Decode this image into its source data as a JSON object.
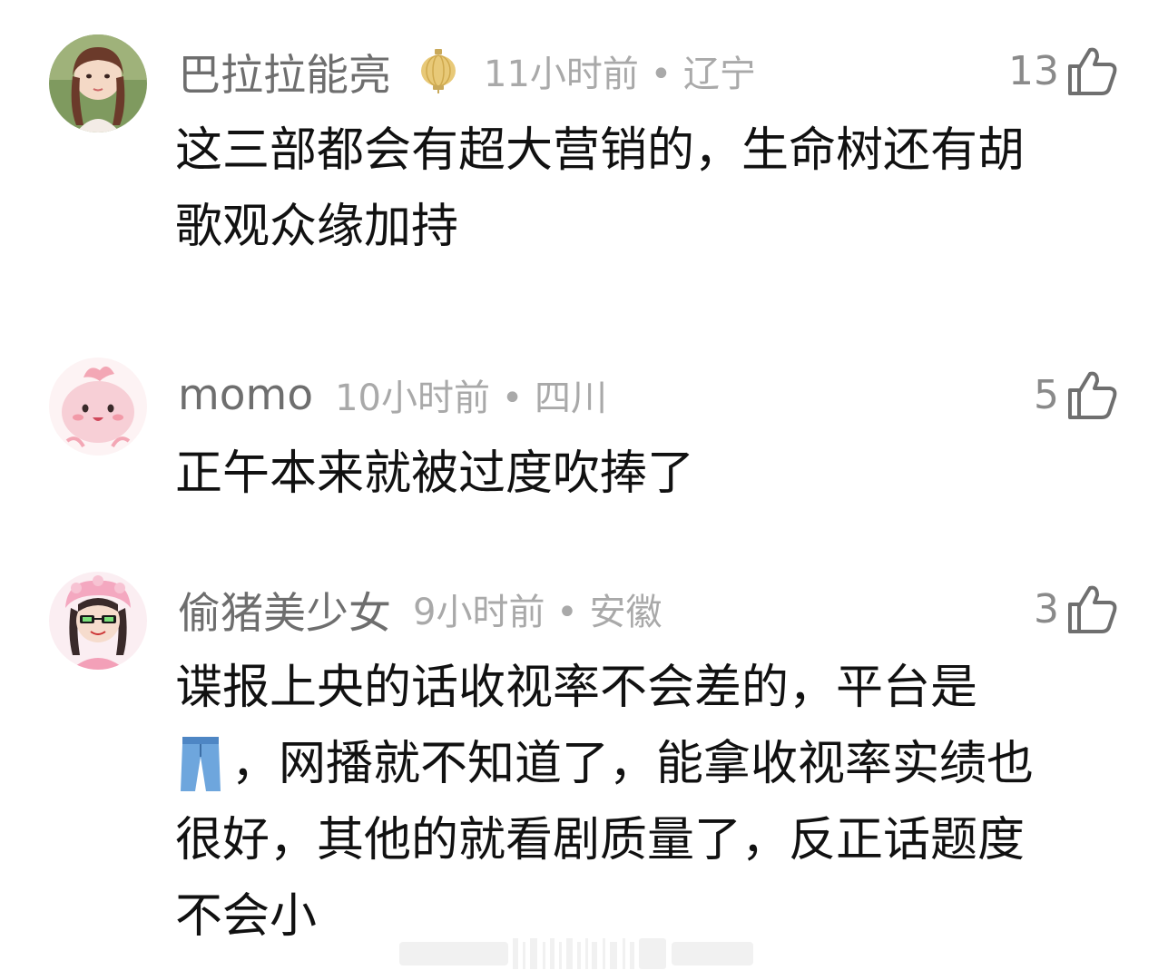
{
  "comments": [
    {
      "username": "巴拉拉能亮",
      "time_location": "11小时前 • 辽宁",
      "likes": "13",
      "text_lines": [
        "这三部都会有超大营销的，生命树还有胡",
        "歌观众缘加持"
      ],
      "badge_icon": "lantern-badge-icon",
      "avatar_icon": "girl-avatar"
    },
    {
      "username": "momo",
      "time_location": "10小时前 • 四川",
      "likes": "5",
      "text_lines": [
        "正午本来就被过度吹捧了"
      ],
      "avatar_icon": "pink-blob-avatar"
    },
    {
      "username": "偷猪美少女",
      "time_location": "9小时前 • 安徽",
      "likes": "3",
      "text_lines": [
        "谍报上央的话收视率不会差的，平台是",
        "，网播就不知道了，能拿收视率实绩也",
        "很好，其他的就看剧质量了，反正话题度",
        "不会小"
      ],
      "inline_emoji": "jeans-emoji",
      "avatar_icon": "cartoon-girl-avatar"
    }
  ],
  "colors": {
    "username": "#6e6e6e",
    "time": "#a9a9a9",
    "text": "#111111",
    "like": "#8a8a8a"
  }
}
